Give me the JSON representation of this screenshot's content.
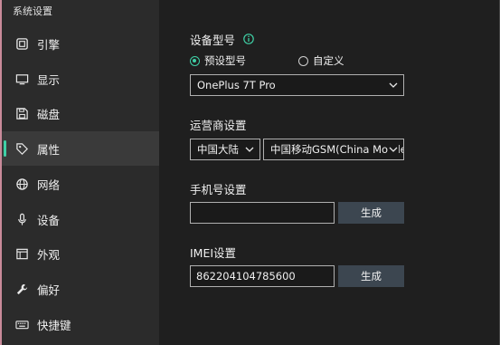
{
  "sidebar": {
    "title": "系统设置",
    "items": [
      {
        "label": "引擎",
        "icon": "engine-icon"
      },
      {
        "label": "显示",
        "icon": "monitor-icon"
      },
      {
        "label": "磁盘",
        "icon": "disk-icon"
      },
      {
        "label": "属性",
        "icon": "tag-icon",
        "active": true
      },
      {
        "label": "网络",
        "icon": "globe-icon"
      },
      {
        "label": "设备",
        "icon": "microphone-icon"
      },
      {
        "label": "外观",
        "icon": "window-icon"
      },
      {
        "label": "偏好",
        "icon": "wrench-icon"
      },
      {
        "label": "快捷键",
        "icon": "keyboard-icon"
      }
    ]
  },
  "device": {
    "label": "设备型号",
    "radio_preset": "预设型号",
    "radio_custom": "自定义",
    "model_value": "OnePlus 7T Pro"
  },
  "carrier": {
    "label": "运营商设置",
    "region_value": "中国大陆",
    "carrier_value": "中国移动GSM(China Mobile)"
  },
  "phone": {
    "label": "手机号设置",
    "value": "",
    "generate_label": "生成"
  },
  "imei": {
    "label": "IMEI设置",
    "value": "862204104785600",
    "generate_label": "生成"
  },
  "colors": {
    "accent": "#3fd0a6",
    "sidebar_bg": "#2b2b2b",
    "main_bg": "#1f1f1f",
    "button_bg": "#3c4650"
  }
}
